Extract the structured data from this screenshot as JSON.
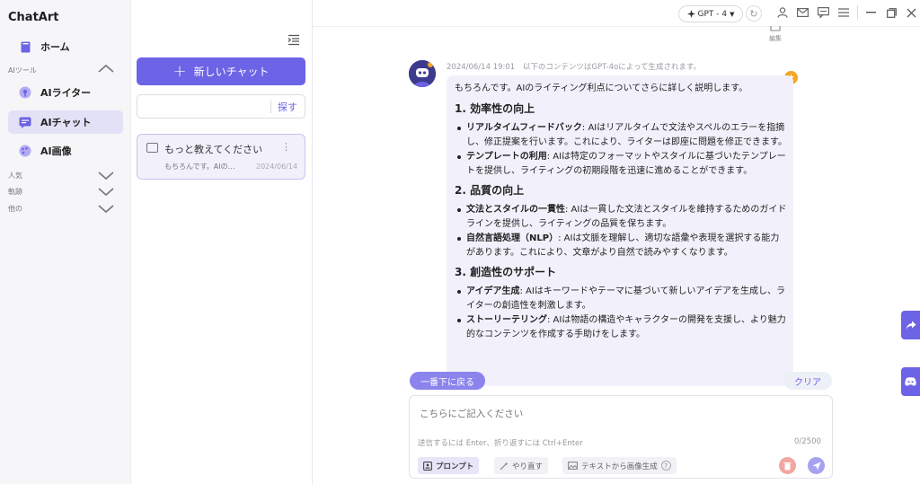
{
  "app": {
    "name": "ChatArt"
  },
  "sidebar": {
    "home": "ホーム",
    "tools_section": "AIツール",
    "items": [
      {
        "label": "AIライター"
      },
      {
        "label": "AIチャット"
      },
      {
        "label": "AI画像"
      }
    ],
    "sections": [
      {
        "label": "人気"
      },
      {
        "label": "軌跡"
      },
      {
        "label": "他の"
      }
    ]
  },
  "chat_list": {
    "new_chat_label": "新しいチャット",
    "search_placeholder": "",
    "search_button": "探す",
    "items": [
      {
        "title": "もっと教えてください",
        "preview": "もちろんです。AIの…",
        "date": "2024/06/14"
      }
    ]
  },
  "topbar": {
    "model": "GPT - 4",
    "edit_label": "編集"
  },
  "message": {
    "timestamp": "2024/06/14 19:01",
    "notice": "以下のコンテンツはGPT-4oによって生成されます。",
    "intro": "もちろんです。AIのライティング利点についてさらに詳しく説明します。",
    "sections": [
      {
        "heading": "1. 効率性の向上",
        "items": [
          {
            "term": "リアルタイムフィードバック",
            "text": ": AIはリアルタイムで文法やスペルのエラーを指摘し、修正提案を行います。これにより、ライターは即座に問題を修正できます。"
          },
          {
            "term": "テンプレートの利用",
            "text": ": AIは特定のフォーマットやスタイルに基づいたテンプレートを提供し、ライティングの初期段階を迅速に進めることができます。"
          }
        ]
      },
      {
        "heading": "2. 品質の向上",
        "items": [
          {
            "term": "文法とスタイルの一貫性",
            "text": ": AIは一貫した文法とスタイルを維持するためのガイドラインを提供し、ライティングの品質を保ちます。"
          },
          {
            "term": "自然言語処理（NLP）",
            "text": ": AIは文脈を理解し、適切な語彙や表現を選択する能力があります。これにより、文章がより自然で読みやすくなります。"
          }
        ]
      },
      {
        "heading": "3. 創造性のサポート",
        "items": [
          {
            "term": "アイデア生成",
            "text": ": AIはキーワードやテーマに基づいて新しいアイデアを生成し、ライターの創造性を刺激します。"
          },
          {
            "term": "ストーリーテリング",
            "text": ": AIは物語の構造やキャラクターの開発を支援し、より魅力的なコンテンツを作成する手助けをします。"
          }
        ]
      }
    ]
  },
  "actions": {
    "scroll_bottom": "一番下に戻る",
    "clear": "クリア"
  },
  "composer": {
    "placeholder": "こちらにご記入ください",
    "hint": "送信するには Enter、折り返すには Ctrl+Enter",
    "counter": "0/2500",
    "tools": [
      {
        "label": "プロンプト"
      },
      {
        "label": "やり直す"
      },
      {
        "label": "テキストから画像生成"
      }
    ]
  },
  "colors": {
    "accent": "#6c63e6",
    "active_bg": "#e3e1f5",
    "bubble_bg": "#f2f1fb"
  }
}
